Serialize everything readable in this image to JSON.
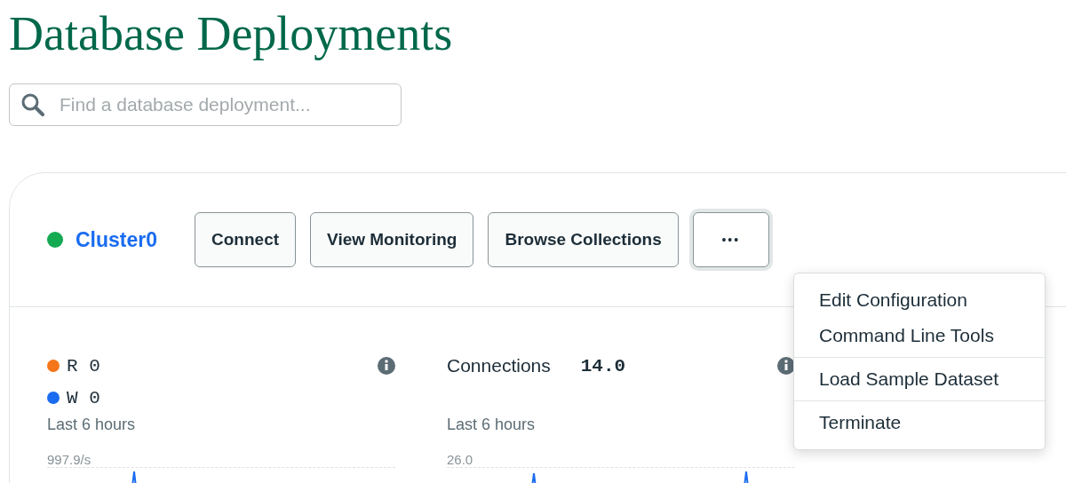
{
  "page_title": "Database Deployments",
  "search": {
    "placeholder": "Find a database deployment..."
  },
  "cluster": {
    "name": "Cluster0",
    "color": "#13aa52",
    "buttons": [
      {
        "label": "Connect"
      },
      {
        "label": "View Monitoring"
      },
      {
        "label": "Browse Collections"
      }
    ],
    "more_button": {
      "label": "•••",
      "menu_open": true
    },
    "menu": [
      {
        "items": [
          "Edit Configuration",
          "Command Line Tools"
        ]
      },
      {
        "items": [
          "Load Sample Dataset"
        ]
      },
      {
        "items": [
          "Terminate"
        ]
      }
    ],
    "metrics": [
      {
        "kind": "legend",
        "legend": [
          {
            "label": "R",
            "value": "0",
            "color": "#f5761a"
          },
          {
            "label": "W",
            "value": "0",
            "color": "#1a6cf0"
          }
        ],
        "period": "Last 6 hours",
        "max": "997.9/s"
      },
      {
        "kind": "titled",
        "title": "Connections",
        "value": "14.0",
        "period": "Last 6 hours",
        "max": "26.0"
      }
    ]
  }
}
